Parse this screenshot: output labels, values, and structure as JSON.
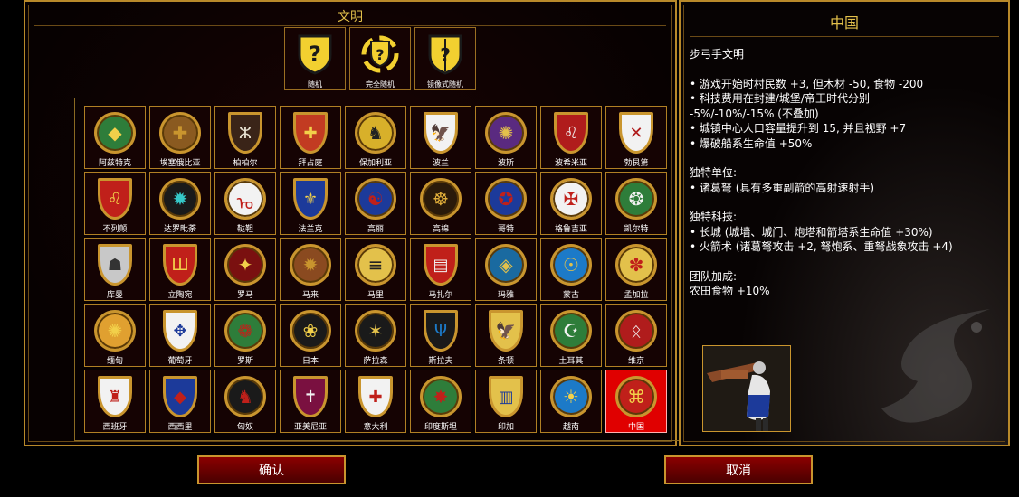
{
  "left": {
    "title": "文明",
    "random_buttons": [
      {
        "label": "随机",
        "icon": "question-shield-icon"
      },
      {
        "label": "完全随机",
        "icon": "full-random-icon"
      },
      {
        "label": "镜像式随机",
        "icon": "mirror-random-icon"
      }
    ]
  },
  "civs": [
    {
      "name": "阿兹特克",
      "shape": "round",
      "bg": "#2e7d3a",
      "fg": "#f2d04a",
      "glyph": "◆"
    },
    {
      "name": "埃塞俄比亚",
      "shape": "round",
      "bg": "#8a5a20",
      "fg": "#c9952e",
      "glyph": "✚"
    },
    {
      "name": "柏柏尔",
      "shape": "heater",
      "bg": "#3a2418",
      "fg": "#e6e0d0",
      "glyph": "ⵣ"
    },
    {
      "name": "拜占庭",
      "shape": "heater",
      "bg": "#c23b22",
      "fg": "#f2d04a",
      "glyph": "✚"
    },
    {
      "name": "保加利亚",
      "shape": "round",
      "bg": "#d8b02a",
      "fg": "#222",
      "glyph": "♞"
    },
    {
      "name": "波兰",
      "shape": "heater",
      "bg": "#f2f2f2",
      "fg": "#c0201a",
      "glyph": "🦅"
    },
    {
      "name": "波斯",
      "shape": "round",
      "bg": "#5a2a80",
      "fg": "#e3c14b",
      "glyph": "✺"
    },
    {
      "name": "波希米亚",
      "shape": "heater",
      "bg": "#b01c1c",
      "fg": "#f2f2f2",
      "glyph": "♌"
    },
    {
      "name": "勃艮第",
      "shape": "heater",
      "bg": "#f2f2f2",
      "fg": "#b01c1c",
      "glyph": "✕"
    },
    {
      "name": "不列颠",
      "shape": "heater",
      "bg": "#c0201a",
      "fg": "#f2d04a",
      "glyph": "♌"
    },
    {
      "name": "达罗毗荼",
      "shape": "round",
      "bg": "#1a1a1a",
      "fg": "#35c8c8",
      "glyph": "✹"
    },
    {
      "name": "鞑靼",
      "shape": "round",
      "bg": "#f2f2f2",
      "fg": "#c0201a",
      "glyph": "ᠣ"
    },
    {
      "name": "法兰克",
      "shape": "heater",
      "bg": "#1c3a9a",
      "fg": "#f2d04a",
      "glyph": "⚜"
    },
    {
      "name": "高丽",
      "shape": "round",
      "bg": "#1c3a9a",
      "fg": "#c0201a",
      "glyph": "☯"
    },
    {
      "name": "高棉",
      "shape": "round",
      "bg": "#2a1a0a",
      "fg": "#e3b03a",
      "glyph": "☸"
    },
    {
      "name": "哥特",
      "shape": "round",
      "bg": "#1c3a9a",
      "fg": "#c0201a",
      "glyph": "✪"
    },
    {
      "name": "格鲁吉亚",
      "shape": "round",
      "bg": "#f2f2f2",
      "fg": "#c0201a",
      "glyph": "✠"
    },
    {
      "name": "凯尔特",
      "shape": "round",
      "bg": "#2e7d3a",
      "fg": "#f2f2f2",
      "glyph": "❂"
    },
    {
      "name": "库曼",
      "shape": "heater",
      "bg": "#c8c8c8",
      "fg": "#333",
      "glyph": "☗"
    },
    {
      "name": "立陶宛",
      "shape": "heater",
      "bg": "#c0201a",
      "fg": "#f2d04a",
      "glyph": "Ш"
    },
    {
      "name": "罗马",
      "shape": "round",
      "bg": "#7a1010",
      "fg": "#f2d04a",
      "glyph": "✦"
    },
    {
      "name": "马来",
      "shape": "round",
      "bg": "#8a4a20",
      "fg": "#c9952e",
      "glyph": "✹"
    },
    {
      "name": "马里",
      "shape": "round",
      "bg": "#e3c14b",
      "fg": "#222",
      "glyph": "≡"
    },
    {
      "name": "马扎尔",
      "shape": "heater",
      "bg": "#c0201a",
      "fg": "#f2f2f2",
      "glyph": "▤"
    },
    {
      "name": "玛雅",
      "shape": "round",
      "bg": "#1a6aa0",
      "fg": "#e3c14b",
      "glyph": "◈"
    },
    {
      "name": "蒙古",
      "shape": "round",
      "bg": "#1c7ac8",
      "fg": "#e3c14b",
      "glyph": "☉"
    },
    {
      "name": "孟加拉",
      "shape": "round",
      "bg": "#e3c14b",
      "fg": "#c0201a",
      "glyph": "✽"
    },
    {
      "name": "缅甸",
      "shape": "round",
      "bg": "#e0a030",
      "fg": "#f2d04a",
      "glyph": "✺"
    },
    {
      "name": "葡萄牙",
      "shape": "heater",
      "bg": "#f2f2f2",
      "fg": "#1c3a9a",
      "glyph": "✥"
    },
    {
      "name": "罗斯",
      "shape": "round",
      "bg": "#2e7d3a",
      "fg": "#c0201a",
      "glyph": "❁"
    },
    {
      "name": "日本",
      "shape": "round",
      "bg": "#1a1a1a",
      "fg": "#f2d04a",
      "glyph": "❀"
    },
    {
      "name": "萨拉森",
      "shape": "round",
      "bg": "#1a1a1a",
      "fg": "#e3c14b",
      "glyph": "✶"
    },
    {
      "name": "斯拉夫",
      "shape": "heater",
      "bg": "#1a1a1a",
      "fg": "#1c7ac8",
      "glyph": "Ψ"
    },
    {
      "name": "条顿",
      "shape": "heater",
      "bg": "#e3c14b",
      "fg": "#1a1a1a",
      "glyph": "🦅"
    },
    {
      "name": "土耳其",
      "shape": "round",
      "bg": "#2e7d3a",
      "fg": "#f2f2f2",
      "glyph": "☪"
    },
    {
      "name": "维京",
      "shape": "round",
      "bg": "#b01c1c",
      "fg": "#f2f2f2",
      "glyph": "ᛟ"
    },
    {
      "name": "西班牙",
      "shape": "heater",
      "bg": "#f2f2f2",
      "fg": "#c0201a",
      "glyph": "♜"
    },
    {
      "name": "西西里",
      "shape": "heater",
      "bg": "#1c3a9a",
      "fg": "#c0201a",
      "glyph": "◆"
    },
    {
      "name": "匈奴",
      "shape": "round",
      "bg": "#1a1a1a",
      "fg": "#c0201a",
      "glyph": "♞"
    },
    {
      "name": "亚美尼亚",
      "shape": "heater",
      "bg": "#7a1040",
      "fg": "#f2f2f2",
      "glyph": "✝"
    },
    {
      "name": "意大利",
      "shape": "heater",
      "bg": "#f2f2f2",
      "fg": "#c0201a",
      "glyph": "✚"
    },
    {
      "name": "印度斯坦",
      "shape": "round",
      "bg": "#2e7d3a",
      "fg": "#c0201a",
      "glyph": "✸"
    },
    {
      "name": "印加",
      "shape": "heater",
      "bg": "#e3c14b",
      "fg": "#1c3a9a",
      "glyph": "▥"
    },
    {
      "name": "越南",
      "shape": "round",
      "bg": "#1c7ac8",
      "fg": "#f2d04a",
      "glyph": "☀"
    },
    {
      "name": "中国",
      "shape": "round",
      "bg": "#c0201a",
      "fg": "#f2d04a",
      "glyph": "⌘",
      "selected": true
    }
  ],
  "buttons": {
    "confirm": "确认",
    "cancel": "取消"
  },
  "info": {
    "title": "中国",
    "lines": [
      "步弓手文明",
      "",
      "• 游戏开始时村民数 +3, 但木材 -50, 食物 -200",
      "• 科技费用在封建/城堡/帝王时代分别",
      "-5%/-10%/-15% (不叠加)",
      "• 城镇中心人口容量提升到 15, 并且视野 +7",
      "• 爆破船系生命值 +50%",
      "",
      "独特单位:",
      "• 诸葛弩 (具有多重副箭的高射速射手)",
      "",
      "独特科技:",
      "• 长城 (城墙、城门、炮塔和箭塔系生命值 +30%)",
      "• 火箭术 (诸葛弩攻击 +2, 弩炮系、重弩战象攻击 +4)",
      "",
      "团队加成:",
      "农田食物 +10%"
    ],
    "unit_icon": "chu-ko-nu-portrait"
  },
  "colors": {
    "accent": "#e3c14b",
    "border": "#c9952e",
    "selected": "#e00000"
  }
}
